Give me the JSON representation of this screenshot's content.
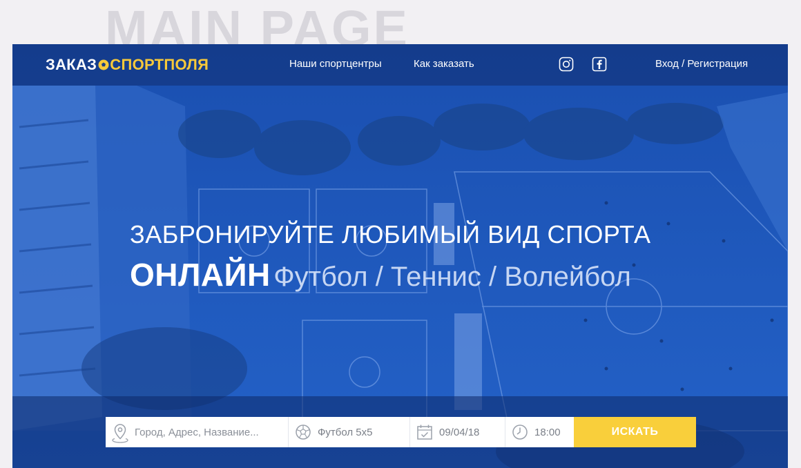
{
  "page_label": "MAIN PAGE",
  "header": {
    "logo_part1": "ЗАКАЗ",
    "logo_part2": "СПОРТПОЛЯ",
    "nav": [
      {
        "label": "Наши спортцентры"
      },
      {
        "label": "Как заказать"
      }
    ],
    "social": [
      {
        "icon": "instagram-icon"
      },
      {
        "icon": "facebook-icon"
      }
    ],
    "auth_label": "Вход / Регистрация"
  },
  "hero": {
    "line1": "ЗАБРОНИРУЙТЕ ЛЮБИМЫЙ ВИД СПОРТА",
    "line2_strong": "ОНЛАЙН",
    "line2_light": "Футбол / Теннис / Волейбол"
  },
  "search": {
    "location_placeholder": "Город, Адрес, Название...",
    "sport_value": "Футбол 5х5",
    "date_value": "09/04/18",
    "time_value": "18:00",
    "button_label": "ИСКАТЬ"
  },
  "colors": {
    "accent": "#f9cf3b",
    "overlay_blue": "#1d57bc",
    "logo_yellow": "#f7c93a"
  }
}
